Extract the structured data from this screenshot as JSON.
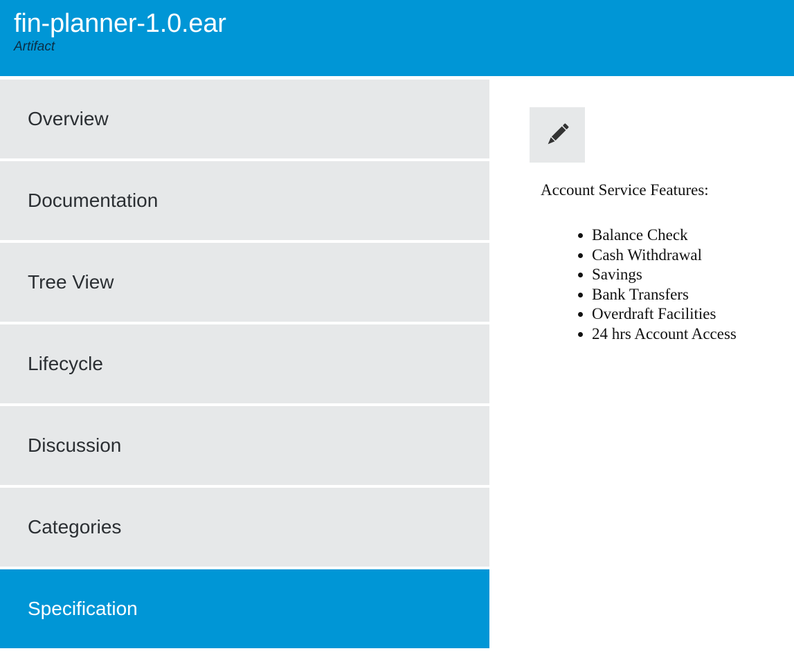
{
  "colors": {
    "accent": "#0096d6",
    "nav_background": "#e6e8e9"
  },
  "header": {
    "title": "fin-planner-1.0.ear",
    "subtitle": "Artifact"
  },
  "sidebar": {
    "items": [
      {
        "label": "Overview",
        "active": false
      },
      {
        "label": "Documentation",
        "active": false
      },
      {
        "label": "Tree View",
        "active": false
      },
      {
        "label": "Lifecycle",
        "active": false
      },
      {
        "label": "Discussion",
        "active": false
      },
      {
        "label": "Categories",
        "active": false
      },
      {
        "label": "Specification",
        "active": true
      }
    ]
  },
  "content": {
    "edit_icon": "pencil-icon",
    "heading": "Account Service Features:",
    "features": [
      "Balance Check",
      "Cash Withdrawal",
      "Savings",
      "Bank Transfers",
      "Overdraft Facilities",
      "24 hrs Account Access"
    ]
  }
}
